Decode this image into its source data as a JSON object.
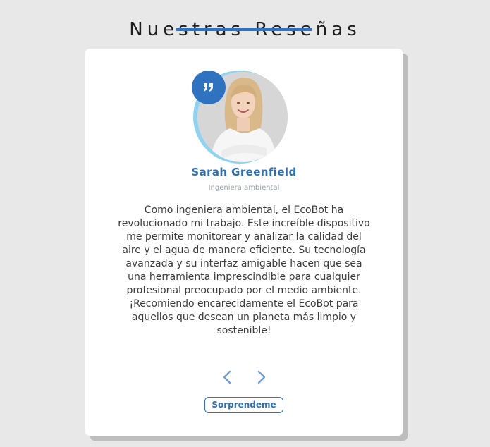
{
  "section": {
    "title": "Nuestras Reseñas"
  },
  "review": {
    "name": "Sarah Greenfield",
    "role": "Ingeniera ambiental",
    "text": "Como ingeniera ambiental, el EcoBot ha revolucionado mi trabajo. Este increíble dispositivo me permite monitorear y analizar la calidad del aire y el agua de manera eficiente. Su tecnología avanzada y su interfaz amigable hacen que sea una herramienta imprescindible para cualquier profesional preocupado por el medio ambiente. ¡Recomiendo encarecidamente el EcoBot para aquellos que desean un planeta más limpio y sostenible!",
    "avatar_icon": "person-photo",
    "quote_icon": "quote-icon"
  },
  "controls": {
    "prev_icon": "chevron-left-icon",
    "next_icon": "chevron-right-icon",
    "surprise_label": "Sorprendeme"
  },
  "colors": {
    "accent": "#2f72c0",
    "name": "#2f6fb2",
    "ring": "#8fd3f0",
    "background": "#e8e8e8",
    "card": "#ffffff"
  }
}
